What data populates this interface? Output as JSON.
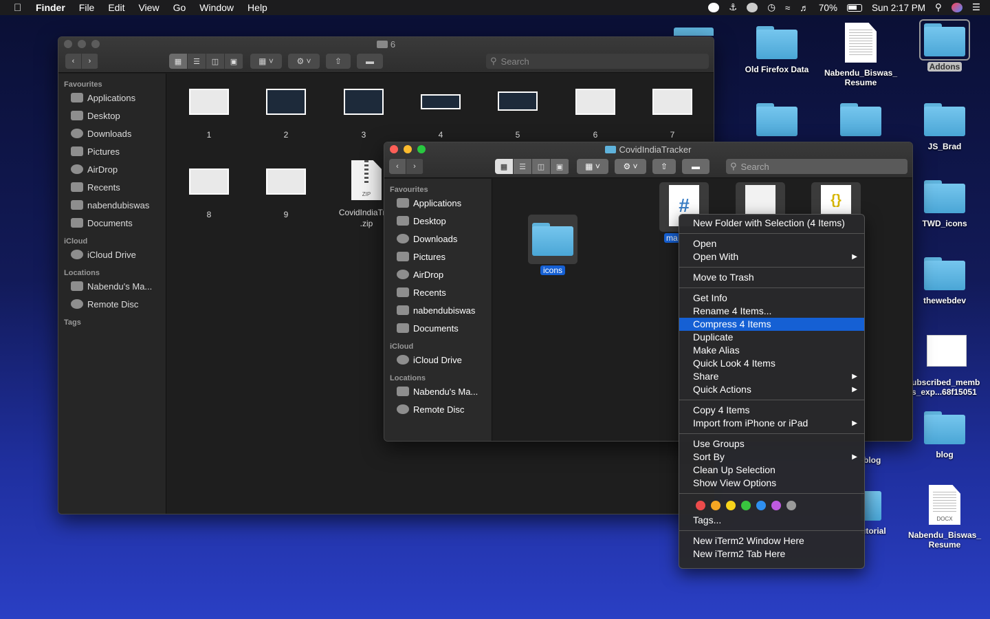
{
  "menubar": {
    "app": "Finder",
    "items": [
      "File",
      "Edit",
      "View",
      "Go",
      "Window",
      "Help"
    ],
    "battery": "70%",
    "clock": "Sun 2:17 PM"
  },
  "desktop": {
    "items": [
      "Old Firefox Data",
      "Nabendu_Biswas_\nResume",
      "Addons",
      "JS_Brad",
      "TWD_icons",
      "thewebdev",
      "ubscribed_memb\ns_exp...68f15051",
      "blog",
      "-blog",
      "utorial",
      "Nabendu_Biswas_\nResume"
    ],
    "docx_tag": "DOCX"
  },
  "back_window": {
    "title": "6",
    "search_placeholder": "Search",
    "sidebar": {
      "favourites_head": "Favourites",
      "favourites": [
        "Applications",
        "Desktop",
        "Downloads",
        "Pictures",
        "AirDrop",
        "Recents",
        "nabendubiswas",
        "Documents"
      ],
      "icloud_head": "iCloud",
      "icloud": [
        "iCloud Drive"
      ],
      "locations_head": "Locations",
      "locations": [
        "Nabendu's Ma...",
        "Remote Disc"
      ],
      "tags_head": "Tags"
    },
    "files": [
      "1",
      "2",
      "3",
      "4",
      "5",
      "6",
      "7",
      "8",
      "9",
      "CovidIndiaTrac\n.zip"
    ],
    "zip_tag": "ZIP"
  },
  "front_window": {
    "title": "CovidIndiaTracker",
    "search_placeholder": "Search",
    "sidebar": {
      "favourites_head": "Favourites",
      "favourites": [
        "Applications",
        "Desktop",
        "Downloads",
        "Pictures",
        "AirDrop",
        "Recents",
        "nabendubiswas",
        "Documents"
      ],
      "icloud_head": "iCloud",
      "icloud": [
        "iCloud Drive"
      ],
      "locations_head": "Locations",
      "locations": [
        "Nabendu's Ma...",
        "Remote Disc"
      ]
    },
    "folder_label": "icons",
    "partial_label": "ma",
    "hash_glyph": "#",
    "json_glyph": "{}"
  },
  "context_menu": {
    "items": [
      "New Folder with Selection (4 Items)",
      "Open",
      "Open With",
      "Move to Trash",
      "Get Info",
      "Rename 4 Items...",
      "Compress 4 Items",
      "Duplicate",
      "Make Alias",
      "Quick Look 4 Items",
      "Share",
      "Quick Actions",
      "Copy 4 Items",
      "Import from iPhone or iPad",
      "Use Groups",
      "Sort By",
      "Clean Up Selection",
      "Show View Options",
      "Tags...",
      "New iTerm2 Window Here",
      "New iTerm2 Tab Here"
    ],
    "highlighted": "Compress 4 Items",
    "tag_colors": [
      "#ec4b4b",
      "#f5a623",
      "#f7d31b",
      "#39c43f",
      "#2e8ff0",
      "#bf5ae0",
      "#9a9a9a"
    ]
  },
  "colors": {
    "menu_highlight": "#1560d4",
    "folder": "#5fb3dc"
  }
}
